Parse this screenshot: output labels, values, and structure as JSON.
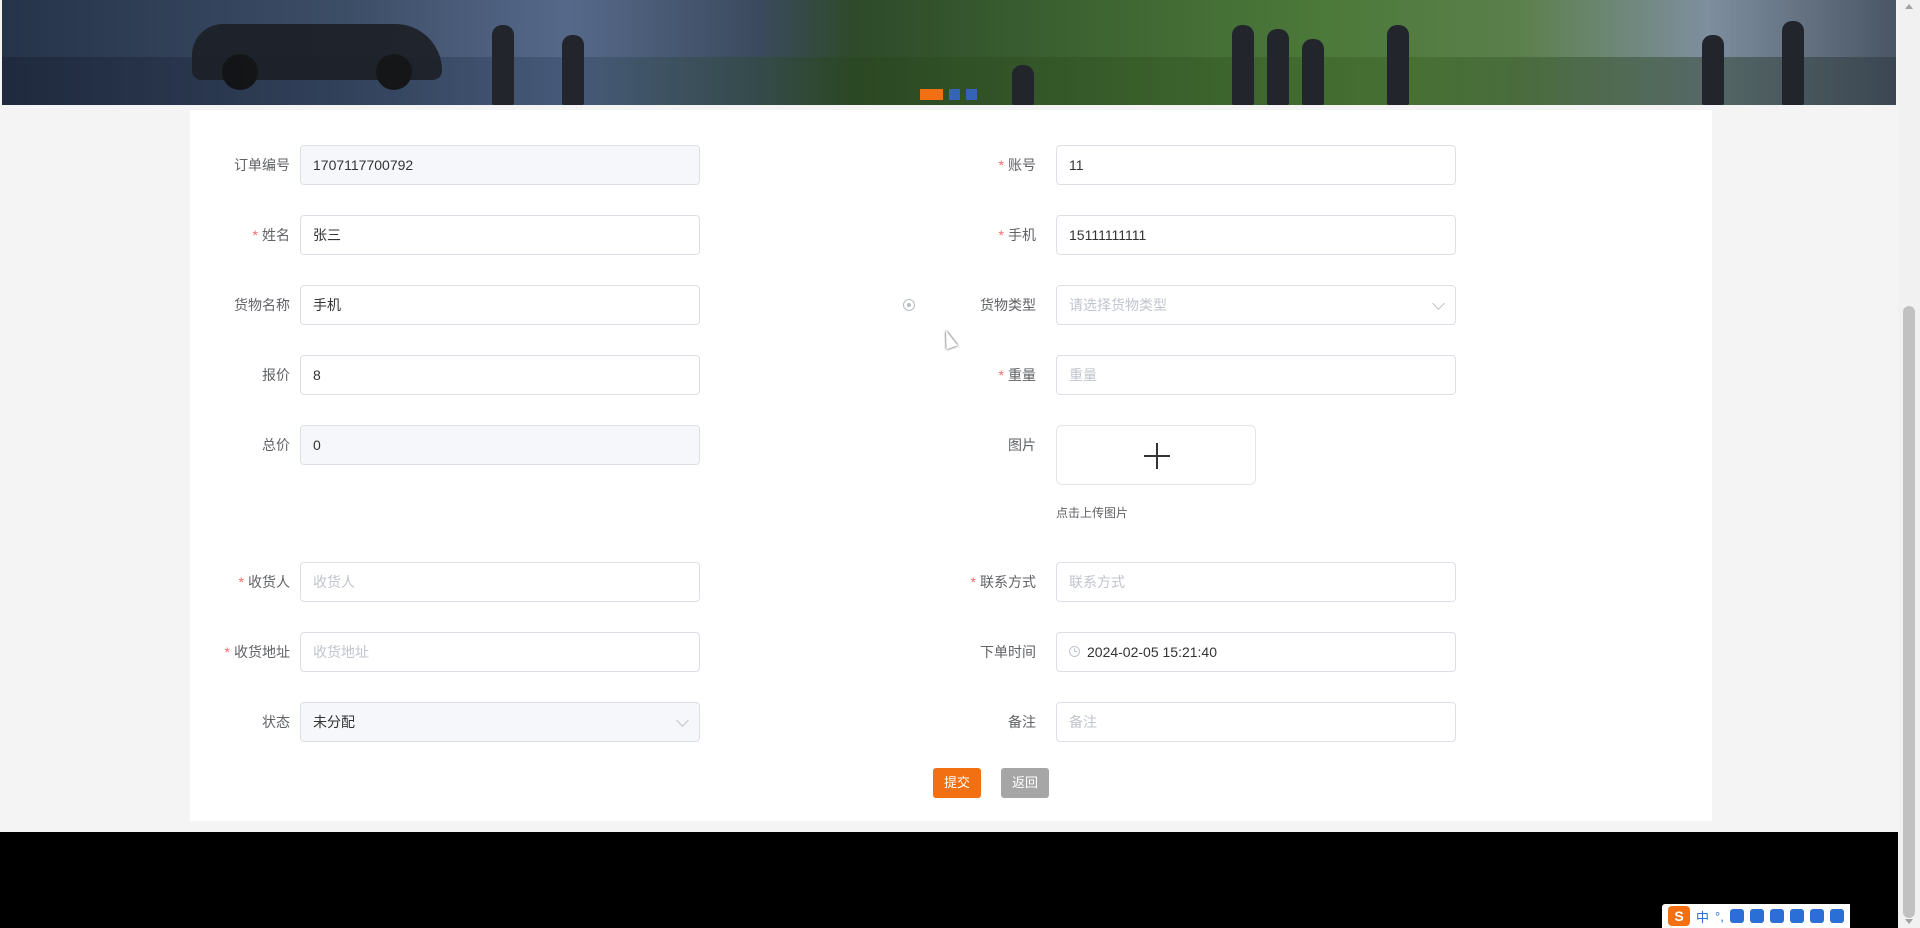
{
  "banner": {
    "indicator_count": 3,
    "active_index": 0,
    "accent_color": "#f26f12",
    "inactive_color": "#3563b5"
  },
  "form": {
    "order_no": {
      "label": "订单编号",
      "value": "1707117700792"
    },
    "account": {
      "label": "账号",
      "value": "11",
      "required": true
    },
    "name": {
      "label": "姓名",
      "value": "张三",
      "required": true
    },
    "phone": {
      "label": "手机",
      "value": "15111111111",
      "required": true
    },
    "goods_name": {
      "label": "货物名称",
      "value": "手机"
    },
    "goods_type": {
      "label": "货物类型",
      "placeholder": "请选择货物类型"
    },
    "price": {
      "label": "报价",
      "value": "8"
    },
    "weight": {
      "label": "重量",
      "placeholder": "重量",
      "required": true
    },
    "total": {
      "label": "总价",
      "value": "0"
    },
    "image": {
      "label": "图片",
      "tip": "点击上传图片"
    },
    "receiver": {
      "label": "收货人",
      "placeholder": "收货人",
      "required": true
    },
    "contact": {
      "label": "联系方式",
      "placeholder": "联系方式",
      "required": true
    },
    "address": {
      "label": "收货地址",
      "placeholder": "收货地址",
      "required": true
    },
    "order_time": {
      "label": "下单时间",
      "value": "2024-02-05 15:21:40"
    },
    "status": {
      "label": "状态",
      "value": "未分配"
    },
    "remark": {
      "label": "备注",
      "placeholder": "备注"
    }
  },
  "buttons": {
    "submit": "提交",
    "back": "返回"
  },
  "required_mark": "*",
  "ime": {
    "logo": "S",
    "mode": "中",
    "punct": "°,"
  }
}
